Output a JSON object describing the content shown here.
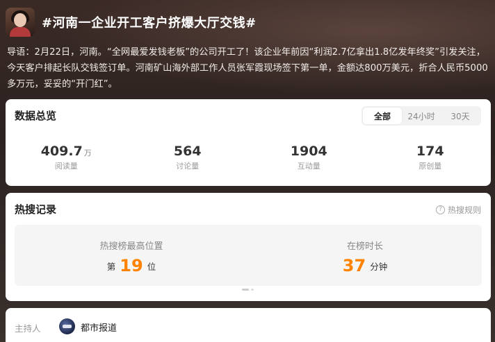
{
  "header": {
    "title": "#河南一企业开工客户挤爆大厅交钱#"
  },
  "lead": {
    "text": "导语：2月22日，河南。“全网最爱发钱老板”的公司开工了！该企业年前因“利润2.7亿拿出1.8亿发年终奖”引发关注，今天客户排起长队交钱签订单。河南矿山海外部工作人员张军霞现场签下第一单，金额达800万美元，折合人民币5000多万元，妥妥的“开门红”。"
  },
  "overview": {
    "title": "数据总览",
    "tabs": [
      "全部",
      "24小时",
      "30天"
    ],
    "active_tab": "全部",
    "stats": [
      {
        "value": "409.7",
        "unit": "万",
        "label": "阅读量"
      },
      {
        "value": "564",
        "unit": "",
        "label": "讨论量"
      },
      {
        "value": "1904",
        "unit": "",
        "label": "互动量"
      },
      {
        "value": "174",
        "unit": "",
        "label": "原创量"
      }
    ]
  },
  "hot_search": {
    "title": "热搜记录",
    "rules_label": "热搜规则",
    "rules_icon": "question-circle-icon",
    "best_position": {
      "label": "热搜榜最高位置",
      "prefix": "第",
      "value": "19",
      "suffix": "位"
    },
    "duration": {
      "label": "在榜时长",
      "value": "37",
      "suffix": "分钟"
    },
    "accent_color": "#ff8200"
  },
  "host": {
    "label": "主持人",
    "name": "都市报道"
  }
}
